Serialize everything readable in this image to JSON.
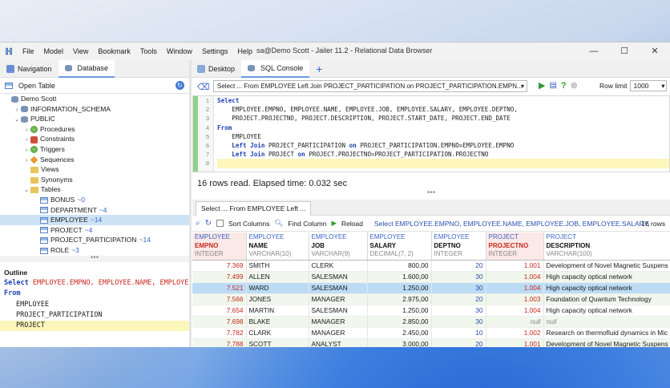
{
  "window": {
    "title": "sa@Demo Scott - Jailer 11.2 - Relational Data Browser",
    "menus": [
      "File",
      "Model",
      "View",
      "Bookmark",
      "Tools",
      "Window",
      "Settings",
      "Help"
    ]
  },
  "left_tabs": [
    "Navigation",
    "Database"
  ],
  "right_tabs": [
    "Desktop",
    "SQL Console"
  ],
  "open_table": "Open Table",
  "tree": [
    {
      "label": "Demo Scott",
      "indent": 0,
      "exp": "",
      "icon": "db"
    },
    {
      "label": "INFORMATION_SCHEMA",
      "indent": 1,
      "exp": "›",
      "icon": "db"
    },
    {
      "label": "PUBLIC",
      "indent": 1,
      "exp": "⌄",
      "icon": "db"
    },
    {
      "label": "Procedures",
      "indent": 2,
      "exp": "›",
      "icon": "green"
    },
    {
      "label": "Constraints",
      "indent": 2,
      "exp": "›",
      "icon": "red"
    },
    {
      "label": "Triggers",
      "indent": 2,
      "exp": "›",
      "icon": "green"
    },
    {
      "label": "Sequences",
      "indent": 2,
      "exp": "›",
      "icon": "orange"
    },
    {
      "label": "Views",
      "indent": 2,
      "exp": "",
      "icon": "folder"
    },
    {
      "label": "Synonyms",
      "indent": 2,
      "exp": "",
      "icon": "folder"
    },
    {
      "label": "Tables",
      "indent": 2,
      "exp": "⌄",
      "icon": "folder"
    },
    {
      "label": "BONUS",
      "count": "0",
      "indent": 3,
      "exp": "",
      "icon": "table"
    },
    {
      "label": "DEPARTMENT",
      "count": "4",
      "indent": 3,
      "exp": "",
      "icon": "table"
    },
    {
      "label": "EMPLOYEE",
      "count": "14",
      "indent": 3,
      "exp": "",
      "icon": "table",
      "selected": true
    },
    {
      "label": "PROJECT",
      "count": "4",
      "indent": 3,
      "exp": "",
      "icon": "table"
    },
    {
      "label": "PROJECT_PARTICIPATION",
      "count": "14",
      "indent": 3,
      "exp": "",
      "icon": "table"
    },
    {
      "label": "ROLE",
      "count": "3",
      "indent": 3,
      "exp": "",
      "icon": "table"
    }
  ],
  "outline": {
    "title": "Outline",
    "select_kw": "Select",
    "select_cols": "EMPLOYEE.EMPNO, EMPLOYEE.NAME, EMPLOYEE",
    "from_kw": "From",
    "items": [
      "EMPLOYEE",
      "PROJECT_PARTICIPATION",
      "PROJECT"
    ]
  },
  "sql": {
    "statement": "Select ... From EMPLOYEE Left Join PROJECT_PARTICIPATION on PROJECT_PARTICIPATION.EMPN...",
    "row_limit_label": "Row limit",
    "row_limit": "1000",
    "lines": [
      [
        {
          "k": true,
          "t": "Select"
        }
      ],
      [
        {
          "t": "    EMPLOYEE.EMPNO, EMPLOYEE.NAME, EMPLOYEE.JOB, EMPLOYEE.SALARY, EMPLOYEE.DEPTNO,"
        }
      ],
      [
        {
          "t": "    PROJECT.PROJECTNO, PROJECT.DESCRIPTION, PROJECT.START_DATE, PROJECT.END_DATE"
        }
      ],
      [
        {
          "k": true,
          "t": "From"
        }
      ],
      [
        {
          "t": "    EMPLOYEE"
        }
      ],
      [
        {
          "k": true,
          "t": "    Left Join"
        },
        {
          "t": " PROJECT_PARTICIPATION "
        },
        {
          "k": true,
          "t": "on"
        },
        {
          "t": " PROJECT_PARTICIPATION.EMPNO=EMPLOYEE.EMPNO"
        }
      ],
      [
        {
          "k": true,
          "t": "    Left Join"
        },
        {
          "t": " PROJECT "
        },
        {
          "k": true,
          "t": "on"
        },
        {
          "t": " PROJECT.PROJECTNO=PROJECT_PARTICIPATION.PROJECTNO"
        }
      ],
      [
        {
          "t": ""
        }
      ]
    ],
    "status": "16 rows read. Elapsed time: 0.032 sec"
  },
  "result": {
    "tab": "Select ... From EMPLOYEE Left ...",
    "sort_columns": "Sort Columns",
    "find_column": "Find Column",
    "reload": "Reload",
    "query": "Select EMPLOYEE.EMPNO, EMPLOYEE.NAME, EMPLOYEE.JOB, EMPLOYEE.SALARY,",
    "row_count": "16 rows",
    "columns": [
      {
        "table": "EMPLOYEE",
        "name": "EMPNO",
        "type": "INTEGER",
        "pk": true
      },
      {
        "table": "EMPLOYEE",
        "name": "NAME",
        "type": "VARCHAR(10)"
      },
      {
        "table": "EMPLOYEE",
        "name": "JOB",
        "type": "VARCHAR(9)"
      },
      {
        "table": "EMPLOYEE",
        "name": "SALARY",
        "type": "DECIMAL(7, 2)"
      },
      {
        "table": "EMPLOYEE",
        "name": "DEPTNO",
        "type": "INTEGER"
      },
      {
        "table": "PROJECT",
        "name": "PROJECTNO",
        "type": "INTEGER",
        "pk": true
      },
      {
        "table": "PROJECT",
        "name": "DESCRIPTION",
        "type": "VARCHAR(100)"
      }
    ],
    "rows": [
      [
        "7.369",
        "SMITH",
        "CLERK",
        "800,00",
        "20",
        "1.001",
        "Development of Novel Magnetic Suspens"
      ],
      [
        "7.499",
        "ALLEN",
        "SALESMAN",
        "1.600,00",
        "30",
        "1.004",
        "High capacity optical network"
      ],
      [
        "7.521",
        "WARD",
        "SALESMAN",
        "1.250,00",
        "30",
        "1.004",
        "High capacity optical network"
      ],
      [
        "7.566",
        "JONES",
        "MANAGER",
        "2.975,00",
        "20",
        "1.003",
        "Foundation of Quantum Technology"
      ],
      [
        "7.654",
        "MARTIN",
        "SALESMAN",
        "1.250,00",
        "30",
        "1.004",
        "High capacity optical network"
      ],
      [
        "7.698",
        "BLAKE",
        "MANAGER",
        "2.850,00",
        "30",
        "null",
        "null"
      ],
      [
        "7.782",
        "CLARK",
        "MANAGER",
        "2.450,00",
        "10",
        "1.002",
        "Research on thermofluid dynamics in Mic"
      ],
      [
        "7.788",
        "SCOTT",
        "ANALYST",
        "3.000,00",
        "20",
        "1.001",
        "Development of Novel Magnetic Suspens"
      ]
    ],
    "selected_row": 2
  }
}
